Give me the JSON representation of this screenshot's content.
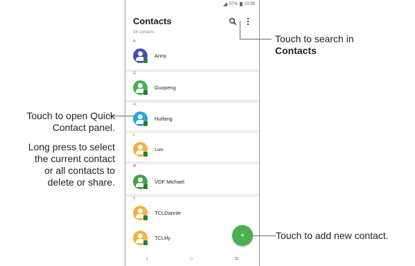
{
  "status_bar": {
    "battery": "57%",
    "time": "10:58"
  },
  "app": {
    "title": "Contacts",
    "count": "16 contacts"
  },
  "icons": {
    "search": "search-icon",
    "more": "more-vert-icon",
    "add": "plus-icon"
  },
  "sections": [
    {
      "letter": "A",
      "contacts": [
        {
          "name": "Anny",
          "color": "#3f51b5"
        }
      ]
    },
    {
      "letter": "G",
      "contacts": [
        {
          "name": "Guopeng",
          "color": "#4caf50"
        }
      ]
    },
    {
      "letter": "H",
      "contacts": [
        {
          "name": "Huifang",
          "color": "#29a3e8"
        }
      ]
    },
    {
      "letter": "L",
      "contacts": [
        {
          "name": "Luo",
          "color": "#f6b23e"
        }
      ]
    },
    {
      "letter": "M",
      "contacts": [
        {
          "name": "VDF Michael",
          "color": "#43a047"
        }
      ]
    },
    {
      "letter": "T",
      "contacts": [
        {
          "name": "TCLDannle",
          "color": "#f6b23e"
        },
        {
          "name": "TCLlily",
          "color": "#f6b23e"
        }
      ]
    }
  ],
  "fab": {
    "label": "+"
  },
  "navbar": {
    "back": "‹",
    "home": "○",
    "recents": "≡"
  },
  "callouts": {
    "search_line1": "Touch to search in",
    "search_line2": "Contacts",
    "quick_line1": "Touch to open Quick",
    "quick_line2": "Contact panel.",
    "long_line1": "Long press to select",
    "long_line2": "the current contact",
    "long_line3": "or all contacts to",
    "long_line4": "delete or share.",
    "add": "Touch to add new contact."
  }
}
